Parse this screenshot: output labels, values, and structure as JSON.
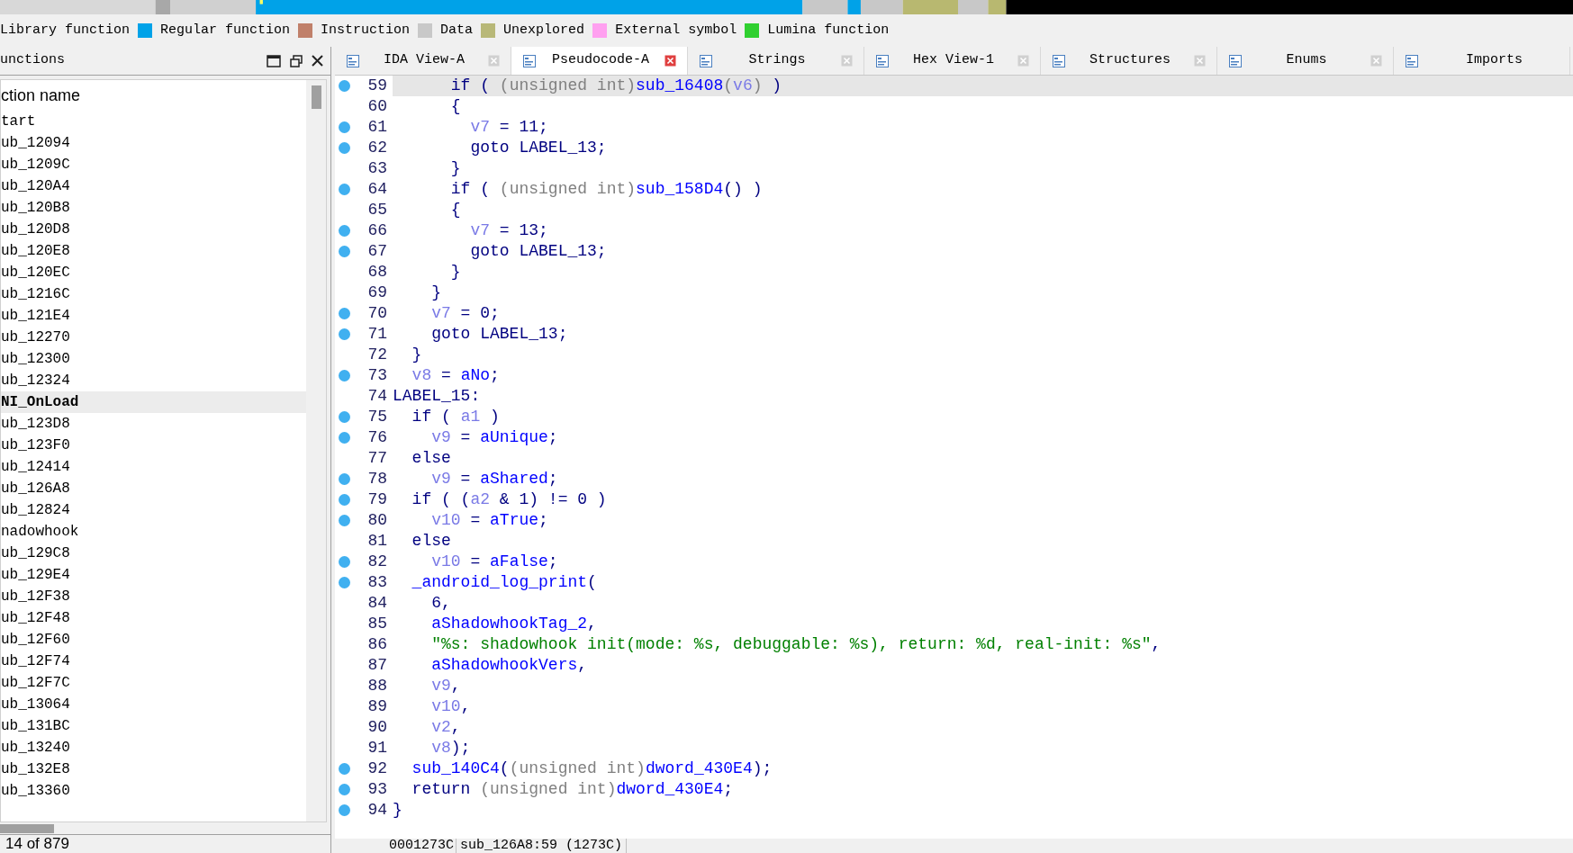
{
  "legend": [
    {
      "label": "Library function"
    },
    {
      "label": "Regular function",
      "color": "#00a2e8"
    },
    {
      "label": "Instruction",
      "color": "#c0806a"
    },
    {
      "label": "Data",
      "color": "#c8c8c8"
    },
    {
      "label": "Unexplored",
      "color": "#b8b878"
    },
    {
      "label": "External symbol",
      "color": "#ffa0f0"
    },
    {
      "label": "Lumina function",
      "color": "#30d030"
    }
  ],
  "functions_panel": {
    "title": "unctions",
    "column": "ction name",
    "footer": "14 of 879",
    "items": [
      {
        "name": "tart",
        "selected": false
      },
      {
        "name": "ub_12094",
        "selected": false
      },
      {
        "name": "ub_1209C",
        "selected": false
      },
      {
        "name": "ub_120A4",
        "selected": false
      },
      {
        "name": "ub_120B8",
        "selected": false
      },
      {
        "name": "ub_120D8",
        "selected": false
      },
      {
        "name": "ub_120E8",
        "selected": false
      },
      {
        "name": "ub_120EC",
        "selected": false
      },
      {
        "name": "ub_1216C",
        "selected": false
      },
      {
        "name": "ub_121E4",
        "selected": false
      },
      {
        "name": "ub_12270",
        "selected": false
      },
      {
        "name": "ub_12300",
        "selected": false
      },
      {
        "name": "ub_12324",
        "selected": false
      },
      {
        "name": "NI_OnLoad",
        "selected": true
      },
      {
        "name": "ub_123D8",
        "selected": false
      },
      {
        "name": "ub_123F0",
        "selected": false
      },
      {
        "name": "ub_12414",
        "selected": false
      },
      {
        "name": "ub_126A8",
        "selected": false
      },
      {
        "name": "ub_12824",
        "selected": false
      },
      {
        "name": "nadowhook",
        "selected": false
      },
      {
        "name": "ub_129C8",
        "selected": false
      },
      {
        "name": "ub_129E4",
        "selected": false
      },
      {
        "name": "ub_12F38",
        "selected": false
      },
      {
        "name": "ub_12F48",
        "selected": false
      },
      {
        "name": "ub_12F60",
        "selected": false
      },
      {
        "name": "ub_12F74",
        "selected": false
      },
      {
        "name": "ub_12F7C",
        "selected": false
      },
      {
        "name": "ub_13064",
        "selected": false
      },
      {
        "name": "ub_131BC",
        "selected": false
      },
      {
        "name": "ub_13240",
        "selected": false
      },
      {
        "name": "ub_132E8",
        "selected": false
      },
      {
        "name": "ub_13360",
        "selected": false
      }
    ]
  },
  "tabs": [
    {
      "label": "IDA View-A",
      "selected": false,
      "closable": true
    },
    {
      "label": "Pseudocode-A",
      "selected": true,
      "closable": true
    },
    {
      "label": "Strings",
      "selected": false,
      "closable": true
    },
    {
      "label": "Hex View-1",
      "selected": false,
      "closable": true
    },
    {
      "label": "Structures",
      "selected": false,
      "closable": true
    },
    {
      "label": "Enums",
      "selected": false,
      "closable": true
    },
    {
      "label": "Imports",
      "selected": false,
      "closable": false
    }
  ],
  "lines": [
    {
      "no": "59",
      "dot": true,
      "current": true,
      "tokens": [
        {
          "kind": "plain",
          "text": "      if ( "
        },
        {
          "kind": "cast",
          "text": "(unsigned int)"
        },
        {
          "kind": "name",
          "text": "sub_16408"
        },
        {
          "kind": "cast",
          "text": "("
        },
        {
          "kind": "var",
          "text": "v6"
        },
        {
          "kind": "cast",
          "text": ")"
        },
        {
          "kind": "plain",
          "text": " )"
        }
      ]
    },
    {
      "no": "60",
      "dot": false,
      "current": false,
      "tokens": [
        {
          "kind": "plain",
          "text": "      {"
        }
      ]
    },
    {
      "no": "61",
      "dot": true,
      "current": false,
      "tokens": [
        {
          "kind": "var",
          "text": "        v7"
        },
        {
          "kind": "plain",
          "text": " = 11;"
        }
      ]
    },
    {
      "no": "62",
      "dot": true,
      "current": false,
      "tokens": [
        {
          "kind": "plain",
          "text": "        goto LABEL_13;"
        }
      ]
    },
    {
      "no": "63",
      "dot": false,
      "current": false,
      "tokens": [
        {
          "kind": "plain",
          "text": "      }"
        }
      ]
    },
    {
      "no": "64",
      "dot": true,
      "current": false,
      "tokens": [
        {
          "kind": "plain",
          "text": "      if ( "
        },
        {
          "kind": "cast",
          "text": "(unsigned int)"
        },
        {
          "kind": "name",
          "text": "sub_158D4"
        },
        {
          "kind": "plain",
          "text": "() )"
        }
      ]
    },
    {
      "no": "65",
      "dot": false,
      "current": false,
      "tokens": [
        {
          "kind": "plain",
          "text": "      {"
        }
      ]
    },
    {
      "no": "66",
      "dot": true,
      "current": false,
      "tokens": [
        {
          "kind": "var",
          "text": "        v7"
        },
        {
          "kind": "plain",
          "text": " = 13;"
        }
      ]
    },
    {
      "no": "67",
      "dot": true,
      "current": false,
      "tokens": [
        {
          "kind": "plain",
          "text": "        goto LABEL_13;"
        }
      ]
    },
    {
      "no": "68",
      "dot": false,
      "current": false,
      "tokens": [
        {
          "kind": "plain",
          "text": "      }"
        }
      ]
    },
    {
      "no": "69",
      "dot": false,
      "current": false,
      "tokens": [
        {
          "kind": "plain",
          "text": "    }"
        }
      ]
    },
    {
      "no": "70",
      "dot": true,
      "current": false,
      "tokens": [
        {
          "kind": "var",
          "text": "    v7"
        },
        {
          "kind": "plain",
          "text": " = 0;"
        }
      ]
    },
    {
      "no": "71",
      "dot": true,
      "current": false,
      "tokens": [
        {
          "kind": "plain",
          "text": "    goto LABEL_13;"
        }
      ]
    },
    {
      "no": "72",
      "dot": false,
      "current": false,
      "tokens": [
        {
          "kind": "plain",
          "text": "  }"
        }
      ]
    },
    {
      "no": "73",
      "dot": true,
      "current": false,
      "tokens": [
        {
          "kind": "var",
          "text": "  v8"
        },
        {
          "kind": "plain",
          "text": " = "
        },
        {
          "kind": "name",
          "text": "aNo"
        },
        {
          "kind": "plain",
          "text": ";"
        }
      ]
    },
    {
      "no": "74",
      "dot": false,
      "current": false,
      "tokens": [
        {
          "kind": "plain",
          "text": "LABEL_15:"
        }
      ]
    },
    {
      "no": "75",
      "dot": true,
      "current": false,
      "tokens": [
        {
          "kind": "plain",
          "text": "  if ( "
        },
        {
          "kind": "var",
          "text": "a1"
        },
        {
          "kind": "plain",
          "text": " )"
        }
      ]
    },
    {
      "no": "76",
      "dot": true,
      "current": false,
      "tokens": [
        {
          "kind": "var",
          "text": "    v9"
        },
        {
          "kind": "plain",
          "text": " = "
        },
        {
          "kind": "name",
          "text": "aUnique"
        },
        {
          "kind": "plain",
          "text": ";"
        }
      ]
    },
    {
      "no": "77",
      "dot": false,
      "current": false,
      "tokens": [
        {
          "kind": "plain",
          "text": "  else"
        }
      ]
    },
    {
      "no": "78",
      "dot": true,
      "current": false,
      "tokens": [
        {
          "kind": "var",
          "text": "    v9"
        },
        {
          "kind": "plain",
          "text": " = "
        },
        {
          "kind": "name",
          "text": "aShared"
        },
        {
          "kind": "plain",
          "text": ";"
        }
      ]
    },
    {
      "no": "79",
      "dot": true,
      "current": false,
      "tokens": [
        {
          "kind": "plain",
          "text": "  if ( ("
        },
        {
          "kind": "var",
          "text": "a2"
        },
        {
          "kind": "plain",
          "text": " & 1) != 0 )"
        }
      ]
    },
    {
      "no": "80",
      "dot": true,
      "current": false,
      "tokens": [
        {
          "kind": "var",
          "text": "    v10"
        },
        {
          "kind": "plain",
          "text": " = "
        },
        {
          "kind": "name",
          "text": "aTrue"
        },
        {
          "kind": "plain",
          "text": ";"
        }
      ]
    },
    {
      "no": "81",
      "dot": false,
      "current": false,
      "tokens": [
        {
          "kind": "plain",
          "text": "  else"
        }
      ]
    },
    {
      "no": "82",
      "dot": true,
      "current": false,
      "tokens": [
        {
          "kind": "var",
          "text": "    v10"
        },
        {
          "kind": "plain",
          "text": " = "
        },
        {
          "kind": "name",
          "text": "aFalse"
        },
        {
          "kind": "plain",
          "text": ";"
        }
      ]
    },
    {
      "no": "83",
      "dot": true,
      "current": false,
      "tokens": [
        {
          "kind": "name",
          "text": "  _android_log_print"
        },
        {
          "kind": "plain",
          "text": "("
        }
      ]
    },
    {
      "no": "84",
      "dot": false,
      "current": false,
      "tokens": [
        {
          "kind": "plain",
          "text": "    6,"
        }
      ]
    },
    {
      "no": "85",
      "dot": false,
      "current": false,
      "tokens": [
        {
          "kind": "name",
          "text": "    aShadowhookTag_2"
        },
        {
          "kind": "plain",
          "text": ","
        }
      ]
    },
    {
      "no": "86",
      "dot": false,
      "current": false,
      "tokens": [
        {
          "kind": "str",
          "text": "    \"%s: shadowhook init(mode: %s, debuggable: %s), return: %d, real-init: %s\""
        },
        {
          "kind": "plain",
          "text": ","
        }
      ]
    },
    {
      "no": "87",
      "dot": false,
      "current": false,
      "tokens": [
        {
          "kind": "name",
          "text": "    aShadowhookVers"
        },
        {
          "kind": "plain",
          "text": ","
        }
      ]
    },
    {
      "no": "88",
      "dot": false,
      "current": false,
      "tokens": [
        {
          "kind": "var",
          "text": "    v9"
        },
        {
          "kind": "plain",
          "text": ","
        }
      ]
    },
    {
      "no": "89",
      "dot": false,
      "current": false,
      "tokens": [
        {
          "kind": "var",
          "text": "    v10"
        },
        {
          "kind": "plain",
          "text": ","
        }
      ]
    },
    {
      "no": "90",
      "dot": false,
      "current": false,
      "tokens": [
        {
          "kind": "var",
          "text": "    v2"
        },
        {
          "kind": "plain",
          "text": ","
        }
      ]
    },
    {
      "no": "91",
      "dot": false,
      "current": false,
      "tokens": [
        {
          "kind": "var",
          "text": "    v8"
        },
        {
          "kind": "plain",
          "text": ");"
        }
      ]
    },
    {
      "no": "92",
      "dot": true,
      "current": false,
      "tokens": [
        {
          "kind": "name",
          "text": "  sub_140C4"
        },
        {
          "kind": "plain",
          "text": "("
        },
        {
          "kind": "cast",
          "text": "(unsigned int)"
        },
        {
          "kind": "name",
          "text": "dword_430E4"
        },
        {
          "kind": "plain",
          "text": ");"
        }
      ]
    },
    {
      "no": "93",
      "dot": true,
      "current": false,
      "tokens": [
        {
          "kind": "plain",
          "text": "  return "
        },
        {
          "kind": "cast",
          "text": "(unsigned int)"
        },
        {
          "kind": "name",
          "text": "dword_430E4"
        },
        {
          "kind": "plain",
          "text": ";"
        }
      ]
    },
    {
      "no": "94",
      "dot": true,
      "current": false,
      "tokens": [
        {
          "kind": "plain",
          "text": "}"
        }
      ]
    }
  ],
  "status_bar": {
    "address": "0001273C",
    "location": "sub_126A8:59 (1273C)"
  }
}
